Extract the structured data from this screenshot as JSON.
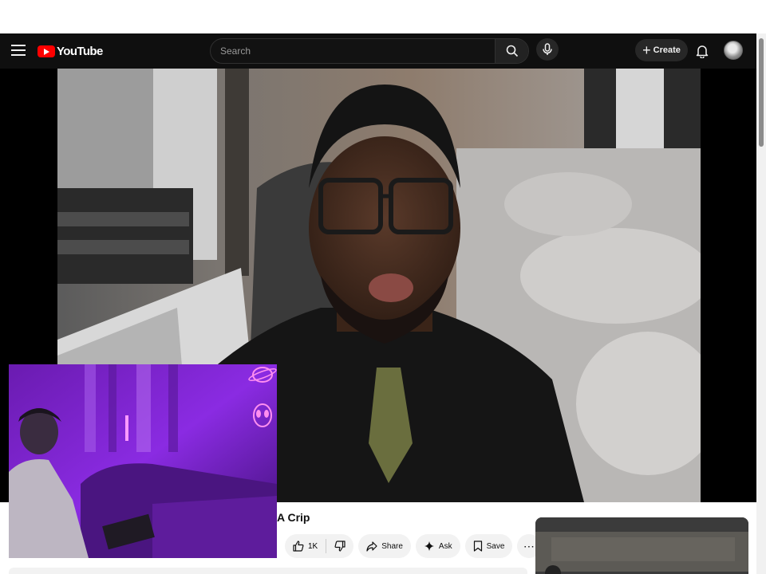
{
  "masthead": {
    "logo_text": "YouTube",
    "search_placeholder": "Search",
    "create_label": "Create"
  },
  "video": {
    "title": "A Crip"
  },
  "actions": {
    "like_count": "1K",
    "share_label": "Share",
    "ask_label": "Ask",
    "save_label": "Save"
  },
  "colors": {
    "masthead_bg": "#0f0f0f",
    "brand_red": "#ff0000",
    "pill_bg": "#f2f2f2",
    "webcam_purple": "#8a2be2"
  }
}
